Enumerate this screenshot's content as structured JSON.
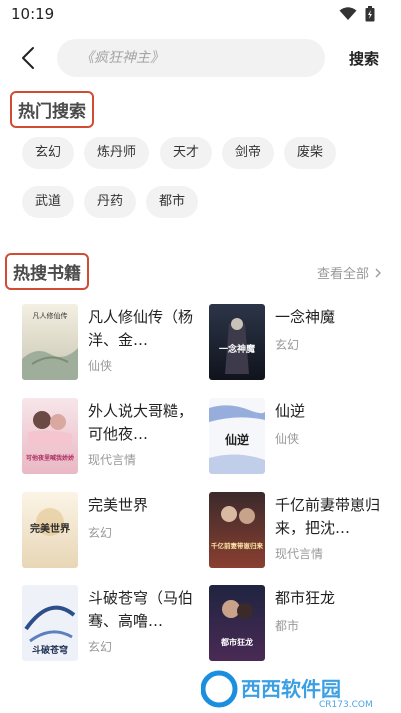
{
  "status": {
    "time": "10:19"
  },
  "search": {
    "placeholder": "《疯狂神主》",
    "button_label": "搜索"
  },
  "hot_search": {
    "title": "热门搜索",
    "tags": [
      "玄幻",
      "炼丹师",
      "天才",
      "剑帝",
      "废柴",
      "武道",
      "丹药",
      "都市"
    ]
  },
  "hot_books": {
    "title": "热搜书籍",
    "see_all": "查看全部",
    "books": [
      {
        "title": "凡人修仙传（杨洋、金…",
        "genre": "仙侠",
        "cover_text": "凡人修仙传"
      },
      {
        "title": "一念神魔",
        "genre": "玄幻",
        "cover_text": "一念神魔"
      },
      {
        "title": "外人说大哥糙，可他夜…",
        "genre": "现代言情",
        "cover_text": "可他夜里喊我娇娇"
      },
      {
        "title": "仙逆",
        "genre": "仙侠",
        "cover_text": "仙逆"
      },
      {
        "title": "完美世界",
        "genre": "玄幻",
        "cover_text": "完美世界"
      },
      {
        "title": "千亿前妻带崽归来，把沈…",
        "genre": "现代言情",
        "cover_text": "千亿前妻带崽归来"
      },
      {
        "title": "斗破苍穹（马伯骞、高噜…",
        "genre": "玄幻",
        "cover_text": "斗破苍穹"
      },
      {
        "title": "都市狂龙",
        "genre": "都市",
        "cover_text": "都市狂龙"
      }
    ]
  },
  "watermark": {
    "brand": "西西软件园",
    "domain": "CR173.COM"
  },
  "colors": {
    "highlight_border": "#d24b33",
    "tag_bg": "#f2f2f2",
    "search_bg": "#f2f2f2"
  }
}
